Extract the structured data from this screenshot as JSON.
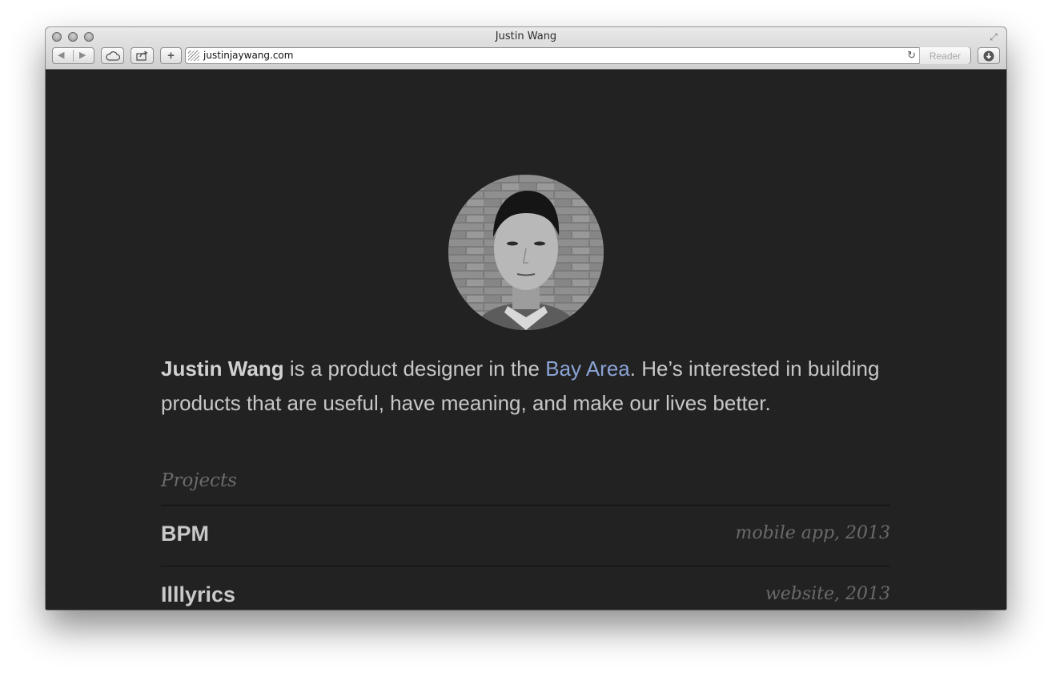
{
  "window": {
    "title": "Justin Wang"
  },
  "toolbar": {
    "back_icon": "back-arrow-icon",
    "forward_icon": "forward-arrow-icon",
    "icloud_icon": "cloud-icon",
    "share_icon": "share-icon",
    "add_label": "+",
    "url": "justinjaywang.com",
    "reader_label": "Reader",
    "downloads_icon": "download-icon"
  },
  "colors": {
    "background": "#222222",
    "link": "#8aa3d6",
    "text": "#c7c7c7",
    "muted": "#6a6a6a"
  },
  "intro": {
    "name": "Justin Wang",
    "text_before_link": " is a product designer in the ",
    "link": "Bay Area",
    "text_after_link": ". He’s interested in building products that are useful, have meaning, and make our lives better."
  },
  "projects": {
    "heading": "Projects",
    "items": [
      {
        "name": "BPM",
        "meta": "mobile app, 2013"
      },
      {
        "name": "Illlyrics",
        "meta": "website, 2013"
      }
    ]
  }
}
